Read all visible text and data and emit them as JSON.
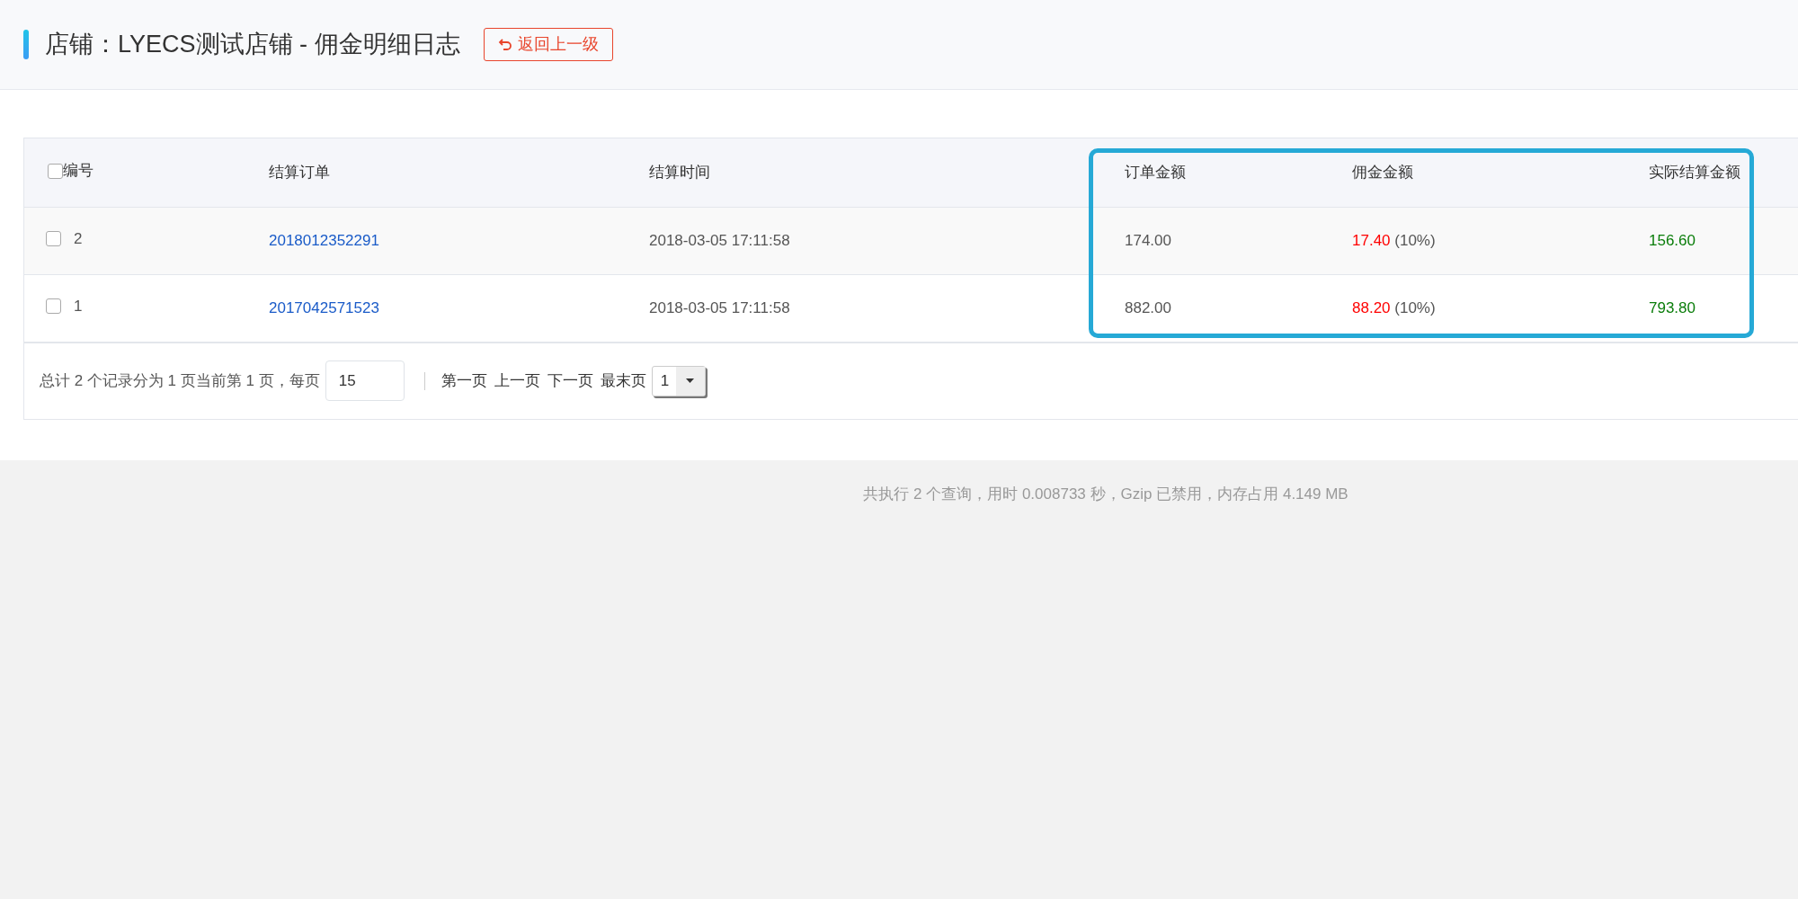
{
  "header": {
    "title": "店铺：LYECS测试店铺 - 佣金明细日志",
    "back_button": "返回上一级"
  },
  "table": {
    "select_all": {
      "checked": false
    },
    "columns": [
      "编号",
      "结算订单",
      "结算时间",
      "订单金额",
      "佣金金额",
      "实际结算金额"
    ],
    "rows": [
      {
        "checked": false,
        "id": "2",
        "order": "2018012352291",
        "time": "2018-03-05 17:11:58",
        "amount": "174.00",
        "commission": "17.40",
        "rate": "(10%)",
        "actual": "156.60"
      },
      {
        "checked": false,
        "id": "1",
        "order": "2017042571523",
        "time": "2018-03-05 17:11:58",
        "amount": "882.00",
        "commission": "88.20",
        "rate": "(10%)",
        "actual": "793.80"
      }
    ]
  },
  "pagination": {
    "summary": "总计 2 个记录分为 1 页当前第 1 页，每页",
    "page_size": "15",
    "links": [
      "第一页",
      "上一页",
      "下一页",
      "最末页"
    ],
    "page_select": "1"
  },
  "footer": "共执行 2 个查询，用时 0.008733 秒，Gzip 已禁用，内存占用 4.149 MB"
}
